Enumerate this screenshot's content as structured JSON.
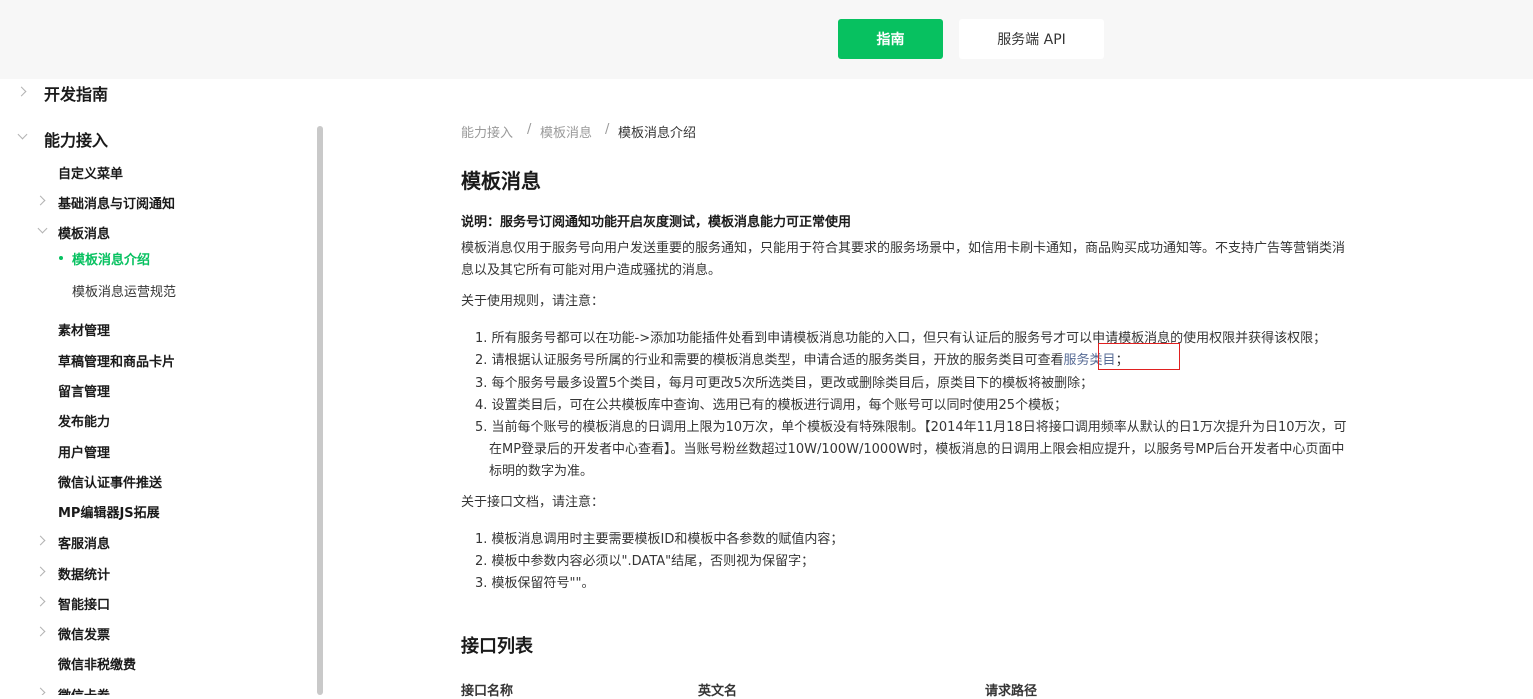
{
  "header": {
    "guide_label": "指南",
    "api_label": "服务端 API"
  },
  "sidebar": {
    "dev_guide": "开发指南",
    "capability": "能力接入",
    "items": {
      "custom_menu": "自定义菜单",
      "basic_msg": "基础消息与订阅通知",
      "template_msg": "模板消息",
      "template_intro": "模板消息介绍",
      "template_rules": "模板消息运营规范",
      "material": "素材管理",
      "draft": "草稿管理和商品卡片",
      "comment": "留言管理",
      "publish": "发布能力",
      "user": "用户管理",
      "verify_push": "微信认证事件推送",
      "mp_editor": "MP编辑器JS拓展",
      "customer_service": "客服消息",
      "stats": "数据统计",
      "smart_api": "智能接口",
      "invoice": "微信发票",
      "nontax": "微信非税缴费",
      "card": "微信卡券"
    }
  },
  "breadcrumb": {
    "level1": "能力接入",
    "level2": "模板消息",
    "current": "模板消息介绍",
    "sep": "/"
  },
  "content": {
    "title": "模板消息",
    "note": "说明：服务号订阅通知功能开启灰度测试，模板消息能力可正常使用",
    "intro_line1": "模板消息仅用于服务号向用户发送重要的服务通知，只能用于符合其要求的服务场景中，如信用卡刷卡通知，商品购买成功通知等。不支持广告等营销类消",
    "intro_line2": "息以及其它所有可能对用户造成骚扰的消息。",
    "rules_heading": "关于使用规则，请注意：",
    "rules": {
      "r1": "1. 所有服务号都可以在功能->添加功能插件处看到申请模板消息功能的入口，但只有认证后的服务号才可以申请模板消息的使用权限并获得该权限；",
      "r2_pre": "2. 请根据认证服务号所属的行业和需要的模板消息类型，申请合适的服务类目，开放的服务类目可查看",
      "r2_link": "服务类目",
      "r2_post": "；",
      "r3": "3. 每个服务号最多设置5个类目，每月可更改5次所选类目，更改或删除类目后，原类目下的模板将被删除；",
      "r4": "4. 设置类目后，可在公共模板库中查询、选用已有的模板进行调用，每个账号可以同时使用25个模板；",
      "r5_l1": "5. 当前每个账号的模板消息的日调用上限为10万次，单个模板没有特殊限制。【2014年11月18日将接口调用频率从默认的日1万次提升为日10万次，可",
      "r5_l2": "在MP登录后的开发者中心查看】。当账号粉丝数超过10W/100W/1000W时，模板消息的日调用上限会相应提升，以服务号MP后台开发者中心页面中",
      "r5_l3": "标明的数字为准。"
    },
    "doc_heading": "关于接口文档，请注意：",
    "docs": {
      "d1": "1. 模板消息调用时主要需要模板ID和模板中各参数的赋值内容；",
      "d2": "2. 模板中参数内容必须以\".DATA\"结尾，否则视为保留字；",
      "d3": "3. 模板保留符号\"\"。"
    },
    "api_list_title": "接口列表",
    "table_headers": {
      "name": "接口名称",
      "en_name": "英文名",
      "path": "请求路径"
    }
  }
}
